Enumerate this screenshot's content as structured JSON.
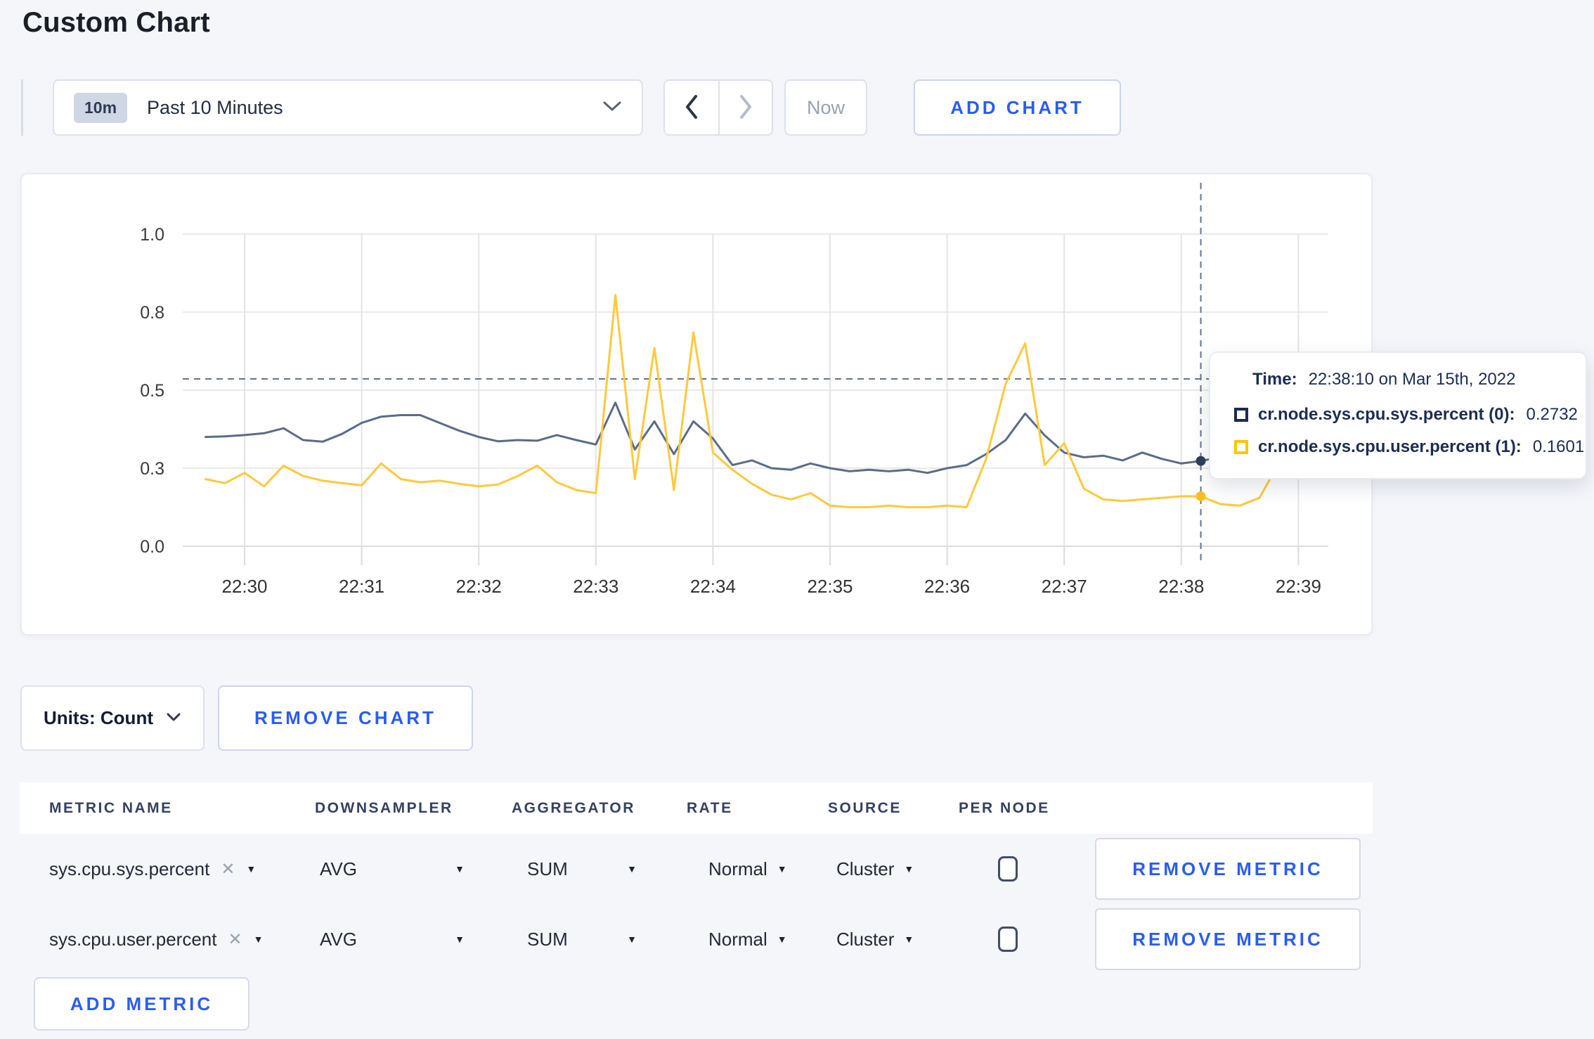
{
  "page": {
    "title": "Custom Chart",
    "background": "#f5f6fa",
    "accent_blue": "#2b5cf0"
  },
  "toolbar": {
    "range_badge": "10m",
    "range_label": "Past 10 Minutes",
    "back_label": "previous time range",
    "forward_label": "next time range",
    "now_label": "Now",
    "add_chart_label": "ADD CHART"
  },
  "chart_data": {
    "type": "line",
    "title": "",
    "xlabel": "",
    "ylabel": "",
    "ylim": [
      0,
      1
    ],
    "grid": true,
    "legend_position": "none",
    "y_tick_labels": [
      "1.0",
      "0.8",
      "0.5",
      "0.3",
      "0.0"
    ],
    "y_tick_values": [
      1.0,
      0.75,
      0.5,
      0.25,
      0.0
    ],
    "x_tick_labels": [
      "22:30",
      "22:31",
      "22:32",
      "22:33",
      "22:34",
      "22:35",
      "22:36",
      "22:37",
      "22:38",
      "22:39"
    ],
    "x_start_seconds_after_2230": -20,
    "x_step_seconds": 10,
    "crosshair": {
      "x_seconds": 490,
      "y_value": 0.536
    },
    "series": [
      {
        "name": "cr.node.sys.cpu.sys.percent (0)",
        "color": "#5c6b88",
        "dot_color": "#2e3f5e",
        "values": [
          0.35,
          0.352,
          0.356,
          0.362,
          0.378,
          0.34,
          0.335,
          0.36,
          0.395,
          0.415,
          0.42,
          0.42,
          0.395,
          0.37,
          0.35,
          0.336,
          0.34,
          0.338,
          0.356,
          0.34,
          0.326,
          0.46,
          0.31,
          0.4,
          0.295,
          0.4,
          0.345,
          0.26,
          0.275,
          0.25,
          0.245,
          0.265,
          0.25,
          0.24,
          0.245,
          0.24,
          0.245,
          0.235,
          0.25,
          0.26,
          0.295,
          0.34,
          0.425,
          0.355,
          0.3,
          0.285,
          0.29,
          0.275,
          0.3,
          0.28,
          0.265,
          0.2732,
          0.285,
          0.28,
          0.285,
          0.275,
          0.28,
          0.275
        ]
      },
      {
        "name": "cr.node.sys.cpu.user.percent (1)",
        "color": "#ffc93d",
        "dot_color": "#ffbe1f",
        "values": [
          0.215,
          0.202,
          0.235,
          0.192,
          0.258,
          0.225,
          0.21,
          0.202,
          0.195,
          0.265,
          0.215,
          0.205,
          0.21,
          0.2,
          0.192,
          0.198,
          0.225,
          0.258,
          0.205,
          0.18,
          0.17,
          0.805,
          0.215,
          0.635,
          0.18,
          0.685,
          0.3,
          0.245,
          0.2,
          0.165,
          0.15,
          0.17,
          0.13,
          0.125,
          0.125,
          0.13,
          0.125,
          0.125,
          0.13,
          0.125,
          0.28,
          0.52,
          0.65,
          0.26,
          0.33,
          0.185,
          0.15,
          0.145,
          0.15,
          0.155,
          0.16,
          0.1601,
          0.135,
          0.13,
          0.155,
          0.265,
          0.28,
          0.22
        ]
      }
    ]
  },
  "tooltip": {
    "time_label": "Time:",
    "time_value": "22:38:10 on Mar 15th, 2022",
    "entries": [
      {
        "label": "cr.node.sys.cpu.sys.percent (0):",
        "value": "0.2732",
        "color": "#1b2b4d"
      },
      {
        "label": "cr.node.sys.cpu.user.percent (1):",
        "value": "0.1601",
        "color": "#ffc600"
      }
    ]
  },
  "chart_footer": {
    "units_label": "Units: Count",
    "remove_chart_label": "REMOVE CHART"
  },
  "metrics_table": {
    "headers": [
      "METRIC NAME",
      "DOWNSAMPLER",
      "AGGREGATOR",
      "RATE",
      "SOURCE",
      "PER NODE"
    ],
    "remove_metric_label": "REMOVE METRIC",
    "add_metric_label": "ADD METRIC",
    "rows": [
      {
        "metric": "sys.cpu.sys.percent",
        "downsampler": "AVG",
        "aggregator": "SUM",
        "rate": "Normal",
        "source": "Cluster",
        "per_node_checked": false
      },
      {
        "metric": "sys.cpu.user.percent",
        "downsampler": "AVG",
        "aggregator": "SUM",
        "rate": "Normal",
        "source": "Cluster",
        "per_node_checked": false
      }
    ]
  }
}
